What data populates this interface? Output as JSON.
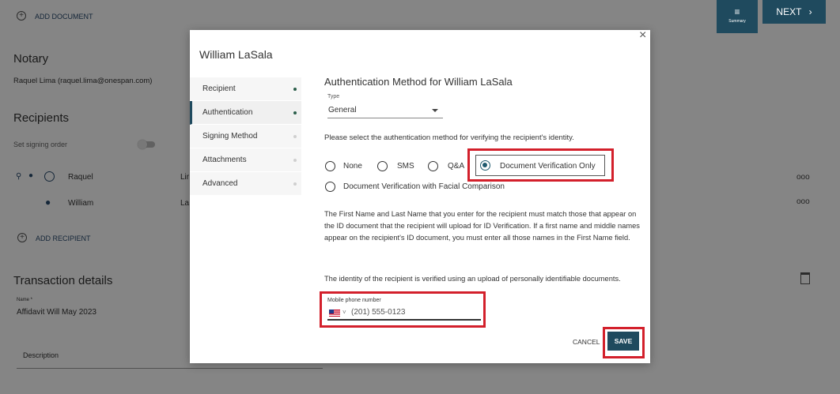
{
  "background": {
    "add_document": "ADD DOCUMENT",
    "notary_heading": "Notary",
    "notary_name": "Raquel Lima (raquel.lima@onespan.com)",
    "recipients_heading": "Recipients",
    "set_signing_order": "Set signing order",
    "recipients": [
      {
        "first": "Raquel",
        "last": "Lir"
      },
      {
        "first": "William",
        "last": "La"
      }
    ],
    "add_recipient": "ADD RECIPIENT",
    "transaction_heading": "Transaction details",
    "name_label": "Name *",
    "name_value": "Affidavit Will May 2023",
    "description_label": "Description",
    "summary_label": "Summary",
    "next_label": "NEXT",
    "more_icon": "ooo"
  },
  "modal": {
    "title": "William LaSala",
    "close_icon": "close-icon",
    "tabs": [
      {
        "label": "Recipient",
        "complete": true
      },
      {
        "label": "Authentication",
        "complete": true
      },
      {
        "label": "Signing Method",
        "complete": false
      },
      {
        "label": "Attachments",
        "complete": false
      },
      {
        "label": "Advanced",
        "complete": false
      }
    ],
    "section_title": "Authentication Method for William LaSala",
    "type_label": "Type",
    "type_value": "General",
    "instruction": "Please select the authentication method for verifying the recipient's identity.",
    "options": [
      {
        "label": "None",
        "selected": false
      },
      {
        "label": "SMS",
        "selected": false
      },
      {
        "label": "Q&A",
        "selected": false
      },
      {
        "label": "Document Verification Only",
        "selected": true
      },
      {
        "label": "Document Verification with Facial Comparison",
        "selected": false
      }
    ],
    "note": "The First Name and Last Name that you enter for the recipient must match those that appear on the ID document that the recipient will upload for ID Verification. If a first name and middle names appear on the recipient's ID document, you must enter all those names in the First Name field.",
    "verify_note": "The identity of the recipient is verified using an upload of personally identifiable documents.",
    "phone_label": "Mobile phone number",
    "phone_value": "(201) 555-0123",
    "cancel_label": "CANCEL",
    "save_label": "SAVE"
  },
  "colors": {
    "primary": "#1f4a5e",
    "highlight": "#d3202b",
    "complete_dot": "#2a5e4a"
  }
}
